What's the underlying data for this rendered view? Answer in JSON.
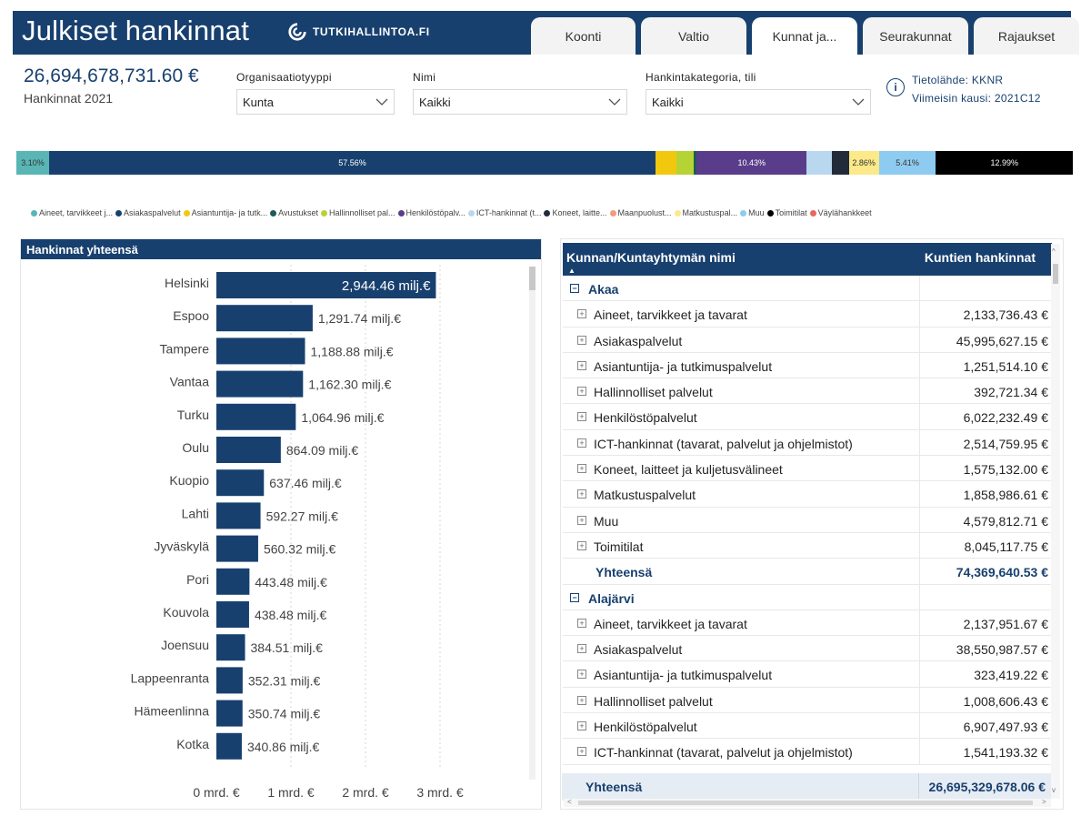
{
  "header": {
    "title": "Julkiset hankinnat",
    "logo_text": "TUTKIHALLINTOA.FI",
    "tabs": [
      {
        "label": "Koonti",
        "active": false
      },
      {
        "label": "Valtio",
        "active": false
      },
      {
        "label": "Kunnat ja...",
        "active": true
      },
      {
        "label": "Seurakunnat",
        "active": false
      },
      {
        "label": "Rajaukset",
        "active": false
      }
    ]
  },
  "kpi": {
    "value": "26,694,678,731.60 €",
    "label": "Hankinnat 2021"
  },
  "filters": {
    "org_type": {
      "label": "Organisaatiotyyppi",
      "value": "Kunta"
    },
    "name": {
      "label": "Nimi",
      "value": "Kaikki"
    },
    "category": {
      "label": "Hankintakategoria, tili",
      "value": "Kaikki"
    }
  },
  "info": {
    "source": "Tietolähde: KKNR",
    "period_label": "Viimeisin kausi:",
    "period_value": "2021C12",
    "icon": "info-icon"
  },
  "stacked_bar": {
    "segments": [
      {
        "share": 3.1,
        "color": "#5ab5b5",
        "label": "3.10%"
      },
      {
        "share": 57.56,
        "color": "#18406f",
        "label": "57.56%"
      },
      {
        "share": 2.0,
        "color": "#f2c80f",
        "label": ""
      },
      {
        "share": 1.6,
        "color": "#b5d334",
        "label": ""
      },
      {
        "share": 0.3,
        "color": "#1f5a5a",
        "label": ""
      },
      {
        "share": 10.43,
        "color": "#5a3d8a",
        "label": "10.43%"
      },
      {
        "share": 2.4,
        "color": "#b9d7ef",
        "label": ""
      },
      {
        "share": 1.6,
        "color": "#222b3a",
        "label": ""
      },
      {
        "share": 2.86,
        "color": "#fbe98a",
        "label": "2.86%"
      },
      {
        "share": 5.41,
        "color": "#8ecbf0",
        "label": "5.41%"
      },
      {
        "share": 12.99,
        "color": "#000000",
        "label": "12.99%"
      }
    ]
  },
  "legend": [
    {
      "label": "Aineet, tarvikkeet j...",
      "color": "#5ab5b5"
    },
    {
      "label": "Asiakaspalvelut",
      "color": "#18406f"
    },
    {
      "label": "Asiantuntija- ja tutk...",
      "color": "#f2c80f"
    },
    {
      "label": "Avustukset",
      "color": "#1f5a5a"
    },
    {
      "label": "Hallinnolliset pal...",
      "color": "#b5d334"
    },
    {
      "label": "Henkilöstöpalv...",
      "color": "#5a3d8a"
    },
    {
      "label": "ICT-hankinnat (t...",
      "color": "#b9d7ef"
    },
    {
      "label": "Koneet, laitte...",
      "color": "#222b3a"
    },
    {
      "label": "Maanpuolust...",
      "color": "#f29b7d"
    },
    {
      "label": "Matkustuspal...",
      "color": "#fbe98a"
    },
    {
      "label": "Muu",
      "color": "#8ecbf0"
    },
    {
      "label": "Toimitilat",
      "color": "#000000"
    },
    {
      "label": "Väylähankkeet",
      "color": "#e8675e"
    }
  ],
  "bar_panel": {
    "title": "Hankinnat yhteensä"
  },
  "chart_data": {
    "type": "bar",
    "orientation": "horizontal",
    "categories": [
      "Helsinki",
      "Espoo",
      "Tampere",
      "Vantaa",
      "Turku",
      "Oulu",
      "Kuopio",
      "Lahti",
      "Jyväskylä",
      "Pori",
      "Kouvola",
      "Joensuu",
      "Lappeenranta",
      "Hämeenlinna",
      "Kotka"
    ],
    "values": [
      2944.46,
      1291.74,
      1188.88,
      1162.3,
      1064.96,
      864.09,
      637.46,
      592.27,
      560.32,
      443.48,
      438.48,
      384.51,
      352.31,
      350.74,
      340.86
    ],
    "value_labels": [
      "2,944.46 milj.€",
      "1,291.74 milj.€",
      "1,188.88 milj.€",
      "1,162.30 milj.€",
      "1,064.96 milj.€",
      "864.09 milj.€",
      "637.46 milj.€",
      "592.27 milj.€",
      "560.32 milj.€",
      "443.48 milj.€",
      "438.48 milj.€",
      "384.51 milj.€",
      "352.31 milj.€",
      "350.74 milj.€",
      "340.86 milj.€"
    ],
    "xticks": [
      "0 mrd. €",
      "1 mrd. €",
      "2 mrd. €",
      "3 mrd. €"
    ],
    "xlim": [
      0,
      3000
    ],
    "bar_color": "#18406f",
    "grid": true
  },
  "table": {
    "col1": "Kunnan/Kuntayhtymän nimi",
    "col2": "Kuntien hankinnat",
    "rows": [
      {
        "type": "group",
        "name": "Akaa",
        "value": ""
      },
      {
        "type": "sub",
        "name": "Aineet, tarvikkeet ja tavarat",
        "value": "2,133,736.43 €"
      },
      {
        "type": "sub",
        "name": "Asiakaspalvelut",
        "value": "45,995,627.15 €"
      },
      {
        "type": "sub",
        "name": "Asiantuntija- ja tutkimuspalvelut",
        "value": "1,251,514.10 €"
      },
      {
        "type": "sub",
        "name": "Hallinnolliset palvelut",
        "value": "392,721.34 €"
      },
      {
        "type": "sub",
        "name": "Henkilöstöpalvelut",
        "value": "6,022,232.49 €"
      },
      {
        "type": "sub",
        "name": "ICT-hankinnat (tavarat, palvelut ja ohjelmistot)",
        "value": "2,514,759.95 €"
      },
      {
        "type": "sub",
        "name": "Koneet, laitteet ja kuljetusvälineet",
        "value": "1,575,132.00 €"
      },
      {
        "type": "sub",
        "name": "Matkustuspalvelut",
        "value": "1,858,986.61 €"
      },
      {
        "type": "sub",
        "name": "Muu",
        "value": "4,579,812.71 €"
      },
      {
        "type": "sub",
        "name": "Toimitilat",
        "value": "8,045,117.75 €"
      },
      {
        "type": "total",
        "name": "Yhteensä",
        "value": "74,369,640.53 €"
      },
      {
        "type": "group",
        "name": "Alajärvi",
        "value": ""
      },
      {
        "type": "sub",
        "name": "Aineet, tarvikkeet ja tavarat",
        "value": "2,137,951.67 €"
      },
      {
        "type": "sub",
        "name": "Asiakaspalvelut",
        "value": "38,550,987.57 €"
      },
      {
        "type": "sub",
        "name": "Asiantuntija- ja tutkimuspalvelut",
        "value": "323,419.22 €"
      },
      {
        "type": "sub",
        "name": "Hallinnolliset palvelut",
        "value": "1,008,606.43 €"
      },
      {
        "type": "sub",
        "name": "Henkilöstöpalvelut",
        "value": "6,907,497.93 €"
      },
      {
        "type": "sub",
        "name": "ICT-hankinnat (tavarat, palvelut ja ohjelmistot)",
        "value": "1,541,193.32 €"
      }
    ],
    "grand_total": {
      "name": "Yhteensä",
      "value": "26,695,329,678.06 €"
    }
  }
}
